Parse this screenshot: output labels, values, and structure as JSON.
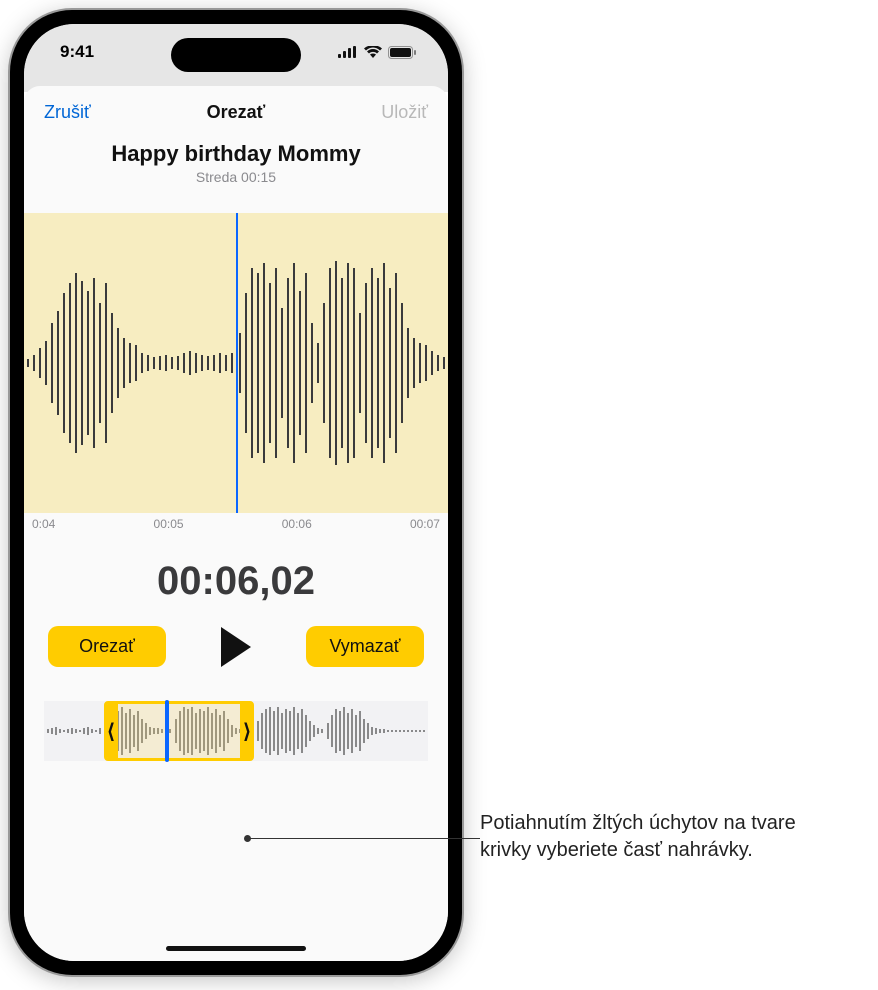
{
  "status": {
    "time": "9:41"
  },
  "sheet": {
    "cancel": "Zrušiť",
    "title": "Orezať",
    "save": "Uložiť"
  },
  "recording": {
    "title": "Happy birthday Mommy",
    "meta": "Streda  00:15"
  },
  "ticks": {
    "t0": "0:04",
    "t1": "00:05",
    "t2": "00:06",
    "t3": "00:07"
  },
  "timecode": "00:06,02",
  "buttons": {
    "trim": "Orezať",
    "delete": "Vymazať"
  },
  "callout": "Potiahnutím žltých úchytov na tvare krivky vyberiete časť nahrávky.",
  "colors": {
    "accent_yellow": "#ffcc00",
    "accent_blue": "#0a66ff",
    "wave_bg": "#f7edc1"
  }
}
